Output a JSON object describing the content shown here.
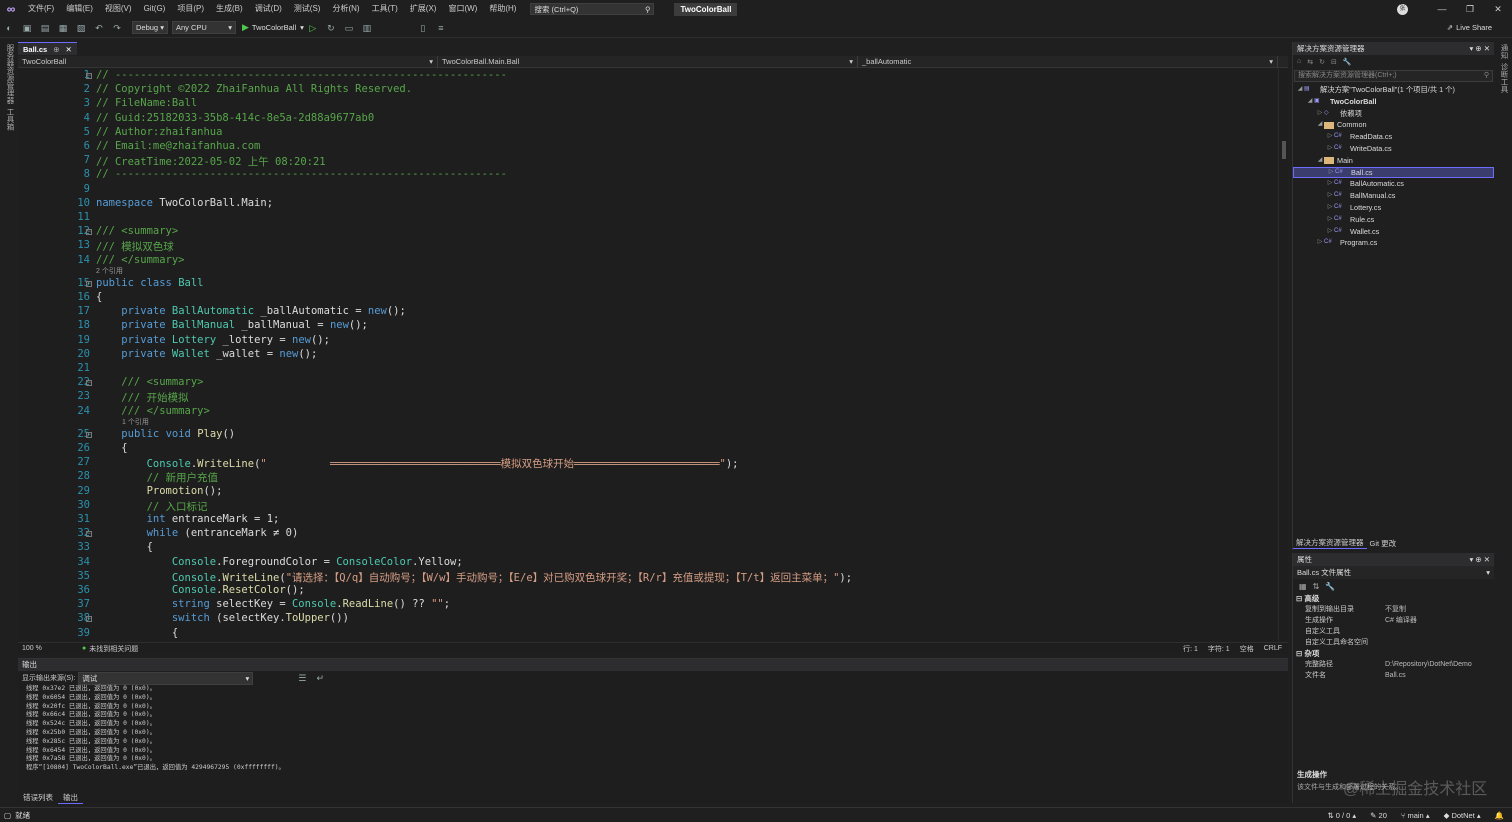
{
  "window": {
    "title": "TwoColorBall",
    "user_initial": "张",
    "live_share": "Live Share"
  },
  "menu": [
    "文件(F)",
    "编辑(E)",
    "视图(V)",
    "Git(G)",
    "项目(P)",
    "生成(B)",
    "调试(D)",
    "测试(S)",
    "分析(N)",
    "工具(T)",
    "扩展(X)",
    "窗口(W)",
    "帮助(H)"
  ],
  "search": {
    "placeholder": "搜索 (Ctrl+Q)"
  },
  "toolbar": {
    "config": "Debug",
    "platform": "Any CPU",
    "run_label": "TwoColorBall"
  },
  "left_rail": {
    "items": [
      "服务器资源管理器",
      "工具箱"
    ]
  },
  "right_rail": {
    "items": [
      "通知",
      "诊断工具"
    ]
  },
  "tab": {
    "name": "Ball.cs",
    "pin": "⊕",
    "close": "✕"
  },
  "nav": {
    "project": "TwoColorBall",
    "class": "TwoColorBall.Main.Ball",
    "member": "_ballAutomatic"
  },
  "code": {
    "lines": [
      {
        "n": "1",
        "t": "// --------------------------------------------------------------"
      },
      {
        "n": "2",
        "t": "// Copyright ©2022 ZhaiFanhua All Rights Reserved."
      },
      {
        "n": "3",
        "t": "// FileName:Ball"
      },
      {
        "n": "4",
        "t": "// Guid:25182033-35b8-414c-8e5a-2d88a9677ab0"
      },
      {
        "n": "5",
        "t": "// Author:zhaifanhua"
      },
      {
        "n": "6",
        "t": "// Email:me@zhaifanhua.com"
      },
      {
        "n": "7",
        "t": "// CreatTime:2022-05-02 上午 08:20:21"
      },
      {
        "n": "8",
        "t": "// --------------------------------------------------------------"
      },
      {
        "n": "9",
        "t": ""
      },
      {
        "n": "10",
        "t": "namespace TwoColorBall.Main;"
      },
      {
        "n": "11",
        "t": ""
      },
      {
        "n": "12",
        "t": "/// <summary>"
      },
      {
        "n": "13",
        "t": "/// 模拟双色球"
      },
      {
        "n": "14",
        "t": "/// </summary>"
      },
      {
        "n": "15",
        "t": "public class Ball"
      },
      {
        "n": "16",
        "t": "{"
      },
      {
        "n": "17",
        "t": "    private BallAutomatic _ballAutomatic = new();"
      },
      {
        "n": "18",
        "t": "    private BallManual _ballManual = new();"
      },
      {
        "n": "19",
        "t": "    private Lottery _lottery = new();"
      },
      {
        "n": "20",
        "t": "    private Wallet _wallet = new();"
      },
      {
        "n": "21",
        "t": ""
      },
      {
        "n": "22",
        "t": "    /// <summary>"
      },
      {
        "n": "23",
        "t": "    /// 开始模拟"
      },
      {
        "n": "24",
        "t": "    /// </summary>"
      },
      {
        "n": "25",
        "t": "    public void Play()"
      },
      {
        "n": "26",
        "t": "    {"
      },
      {
        "n": "27",
        "t": "        Console.WriteLine(\"          ═══════════════════════════模拟双色球开始═══════════════════════\");"
      },
      {
        "n": "28",
        "t": "        // 新用户充值"
      },
      {
        "n": "29",
        "t": "        Promotion();"
      },
      {
        "n": "30",
        "t": "        // 入口标记"
      },
      {
        "n": "31",
        "t": "        int entranceMark = 1;"
      },
      {
        "n": "32",
        "t": "        while (entranceMark ≠ 0)"
      },
      {
        "n": "33",
        "t": "        {"
      },
      {
        "n": "34",
        "t": "            Console.ForegroundColor = ConsoleColor.Yellow;"
      },
      {
        "n": "35",
        "t": "            Console.WriteLine(\"请选择：【Q/q】自动购号；【W/w】手动购号；【E/e】对已购双色球开奖；【R/r】充值或提现；【T/t】返回主菜单；\");"
      },
      {
        "n": "36",
        "t": "            Console.ResetColor();"
      },
      {
        "n": "37",
        "t": "            string selectKey = Console.ReadLine() ?? \"\";"
      },
      {
        "n": "38",
        "t": "            switch (selectKey.ToUpper())"
      },
      {
        "n": "39",
        "t": "            {"
      }
    ],
    "lens": [
      {
        "after": "14",
        "text": "2 个引用"
      },
      {
        "after": "24",
        "text": "1 个引用"
      }
    ]
  },
  "editor_status": {
    "zoom": "100 %",
    "issues": "未找到相关问题",
    "line": "行: 1",
    "col": "字符: 1",
    "ws": "空格",
    "eol": "CRLF"
  },
  "output": {
    "title": "输出",
    "source_label": "显示输出来源(S):",
    "source_value": "调试",
    "lines": [
      "线程 0x37e2 已退出，返回值为 0 (0x0)。",
      "线程 0x6054 已退出，返回值为 0 (0x0)。",
      "线程 0x20fc 已退出，返回值为 0 (0x0)。",
      "线程 0x66c4 已退出，返回值为 0 (0x0)。",
      "线程 0x524c 已退出，返回值为 0 (0x0)。",
      "线程 0x25b0 已退出，返回值为 0 (0x0)。",
      "线程 0x285c 已退出，返回值为 0 (0x0)。",
      "线程 0x6454 已退出，返回值为 0 (0x0)。",
      "线程 0x7a58 已退出，返回值为 0 (0x0)。",
      "程序“[10804] TwoColorBall.exe”已退出，返回值为 4294967295 (0xffffffff)。"
    ]
  },
  "bottom_tabs": [
    "错误列表",
    "输出"
  ],
  "solution": {
    "title": "解决方案资源管理器",
    "search_placeholder": "搜索解决方案资源管理器(Ctrl+;)",
    "items": [
      {
        "label": "解决方案\"TwoColorBall\"(1 个项目/共 1 个)",
        "indent": 0,
        "kind": "solution",
        "selected": false
      },
      {
        "label": "TwoColorBall",
        "indent": 1,
        "kind": "project",
        "selected": false
      },
      {
        "label": "依赖项",
        "indent": 2,
        "kind": "deps",
        "selected": false
      },
      {
        "label": "Common",
        "indent": 2,
        "kind": "folder",
        "selected": false
      },
      {
        "label": "ReadData.cs",
        "indent": 3,
        "kind": "cs",
        "selected": false
      },
      {
        "label": "WriteData.cs",
        "indent": 3,
        "kind": "cs",
        "selected": false
      },
      {
        "label": "Main",
        "indent": 2,
        "kind": "folder",
        "selected": false
      },
      {
        "label": "Ball.cs",
        "indent": 3,
        "kind": "cs",
        "selected": true
      },
      {
        "label": "BallAutomatic.cs",
        "indent": 3,
        "kind": "cs",
        "selected": false
      },
      {
        "label": "BallManual.cs",
        "indent": 3,
        "kind": "cs",
        "selected": false
      },
      {
        "label": "Lottery.cs",
        "indent": 3,
        "kind": "cs",
        "selected": false
      },
      {
        "label": "Rule.cs",
        "indent": 3,
        "kind": "cs",
        "selected": false
      },
      {
        "label": "Wallet.cs",
        "indent": 3,
        "kind": "cs",
        "selected": false
      },
      {
        "label": "Program.cs",
        "indent": 2,
        "kind": "cs",
        "selected": false
      }
    ],
    "tabs": [
      "解决方案资源管理器",
      "Git 更改"
    ]
  },
  "properties": {
    "title": "属性",
    "object": "Ball.cs 文件属性",
    "cat1": "高级",
    "rows1": [
      {
        "k": "复制到输出目录",
        "v": "不复制"
      },
      {
        "k": "生成操作",
        "v": "C# 编译器"
      },
      {
        "k": "自定义工具",
        "v": ""
      },
      {
        "k": "自定义工具命名空间",
        "v": ""
      }
    ],
    "cat2": "杂项",
    "rows2": [
      {
        "k": "完整路径",
        "v": "D:\\Repository\\DotNet\\Demo"
      },
      {
        "k": "文件名",
        "v": "Ball.cs"
      }
    ],
    "desc_title": "生成操作",
    "desc_text": "该文件与生成和部署过程的关系。",
    "watermark": "@稀土掘金技术社区"
  },
  "statusbar": {
    "ready": "就绪",
    "sync": "0 / 0",
    "edits": "20",
    "branch": "main",
    "repo": "DotNet"
  }
}
